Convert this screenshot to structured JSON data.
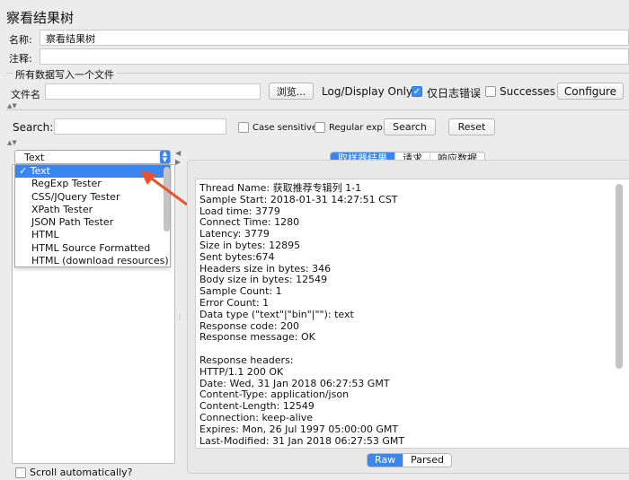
{
  "title": "察看结果树",
  "name_label": "名称:",
  "name_value": "察看结果树",
  "comment_label": "注释:",
  "file_section_label": "所有数据写入一个文件",
  "filename_label": "文件名",
  "browse_label": "浏览...",
  "log_display_label": "Log/Display Only:",
  "errors_only_label": "仅日志错误",
  "successes_label": "Successes",
  "configure_label": "Configure",
  "search_label": "Search:",
  "case_sensitive_label": "Case sensitive",
  "regexp_label": "Regular exp.",
  "search_button": "Search",
  "reset_button": "Reset",
  "renderer": {
    "selected": "Text",
    "options": [
      "✓ Text",
      "RegExp Tester",
      "CSS/JQuery Tester",
      "XPath Tester",
      "JSON Path Tester",
      "HTML",
      "HTML Source Formatted",
      "HTML (download resources)"
    ]
  },
  "tabs": [
    "取样器结果",
    "请求",
    "响应数据"
  ],
  "response_lines": [
    "Thread Name: 获取推荐专辑列 1-1",
    "Sample Start: 2018-01-31 14:27:51 CST",
    "Load time: 3779",
    "Connect Time: 1280",
    "Latency: 3779",
    "Size in bytes: 12895",
    "Sent bytes:674",
    "Headers size in bytes: 346",
    "Body size in bytes: 12549",
    "Sample Count: 1",
    "Error Count: 1",
    "Data type (\"text\"|\"bin\"|\"\"): text",
    "Response code: 200",
    "Response message: OK",
    "",
    "Response headers:",
    "HTTP/1.1 200 OK",
    "Date: Wed, 31 Jan 2018 06:27:53 GMT",
    "Content-Type: application/json",
    "Content-Length: 12549",
    "Connection: keep-alive",
    "Expires: Mon, 26 Jul 1997 05:00:00 GMT",
    "Last-Modified: 31 Jan 2018 06:27:53 GMT"
  ],
  "view_tabs": [
    "Raw",
    "Parsed"
  ],
  "scroll_auto_label": "Scroll automatically?",
  "colors": {
    "accent": "#3a86f1",
    "annotation_arrow": "#e8532e"
  }
}
